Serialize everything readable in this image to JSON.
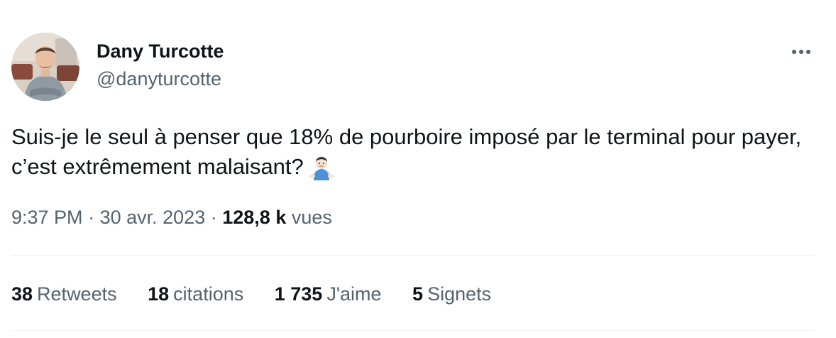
{
  "user": {
    "display_name": "Dany Turcotte",
    "handle": "@danyturcotte",
    "avatar_icon": "profile-photo"
  },
  "more_icon": "ellipsis-horizontal-icon",
  "tweet": {
    "text": "Suis-je le seul à penser que 18% de pourboire imposé par le terminal pour payer, c’est extrêmement malaisant?",
    "emoji": "person-shrugging-emoji"
  },
  "meta": {
    "time": "9:37 PM",
    "separator": "·",
    "date": "30 avr. 2023",
    "views_count": "128,8 k",
    "views_label": "vues"
  },
  "stats": {
    "retweets": {
      "count": "38",
      "label": "Retweets"
    },
    "quotes": {
      "count": "18",
      "label": "citations"
    },
    "likes": {
      "count": "1 735",
      "label": "J'aime"
    },
    "bookmarks": {
      "count": "5",
      "label": "Signets"
    }
  },
  "colors": {
    "primary_text": "#0f1419",
    "secondary_text": "#536471",
    "divider": "#eff3f4"
  }
}
